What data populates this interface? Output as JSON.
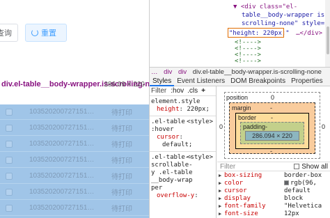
{
  "page": {
    "query_label": "查询",
    "reset_label": "重置",
    "tooltip": {
      "selector": "div.el-table__body-wrapper.is-scrolling-none",
      "dims": "286.09 × 220"
    },
    "rows": [
      {
        "id": "103520200727151…",
        "status": "待打印"
      },
      {
        "id": "103520200727151…",
        "status": "待打印"
      },
      {
        "id": "103520200727151…",
        "status": "待打印"
      },
      {
        "id": "103520200727151…",
        "status": "待打印"
      },
      {
        "id": "103520200727151…",
        "status": "待打印"
      },
      {
        "id": "103520200727151…",
        "status": "待打印"
      },
      {
        "id": "103520200727151…",
        "status": "待打印"
      }
    ]
  },
  "elements": {
    "line1_attr": "<div class=\"el-",
    "line2_attr": "table__body-wrapper is-",
    "line3_attr": "scrolling-none\" style=",
    "line4_style": "\"height: 220px;\"",
    "line4_tail": "…</div> ==",
    "comments": [
      "<!---->",
      "<!---->",
      "<!---->",
      "<!---->",
      "<!---->"
    ]
  },
  "breadcrumb": [
    "…",
    "div",
    "div",
    "div.el-table__body-wrapper.is-scrolling-none"
  ],
  "tabs": [
    "Styles",
    "Event Listeners",
    "DOM Breakpoints",
    "Properties"
  ],
  "styles": {
    "filter": "Filter",
    "hov": ":hov",
    "cls": ".cls",
    "plus": "+",
    "rules": [
      {
        "selector": "element.style",
        "source": "",
        "props": [
          {
            "name": "height",
            "value": "220px;"
          }
        ]
      },
      {
        "selector": ".el-table :hover",
        "source": "<style>",
        "props": [
          {
            "name": "cursor",
            "value": "default;"
          }
        ]
      },
      {
        "selector": ".el-table--scrollable-y .el-table__body-wrapper",
        "source": "<style>",
        "props": [
          {
            "name": "overflow-y",
            "value": ""
          }
        ]
      }
    ]
  },
  "box_model": {
    "position": "position",
    "position_val": "0",
    "margin": "margin",
    "margin_val": "-",
    "border": "border",
    "border_val": "-",
    "padding": "padding-",
    "content": "286.094 × 220",
    "side_left": "0",
    "side_right": "0",
    "bottom_dash": "-"
  },
  "computed": {
    "filter_placeholder": "Filter",
    "show_all": "Show all",
    "rows": [
      {
        "name": "box-sizing",
        "value": "border-box",
        "swatch": false
      },
      {
        "name": "color",
        "value": "rgb(96, ",
        "swatch": true
      },
      {
        "name": "cursor",
        "value": "default",
        "swatch": false
      },
      {
        "name": "display",
        "value": "block",
        "swatch": false
      },
      {
        "name": "font-family",
        "value": "\"Helvetica",
        "swatch": false
      },
      {
        "name": "font-size",
        "value": "12px",
        "swatch": false
      }
    ]
  },
  "colors": {
    "highlight": "#a0c5e8",
    "accent": "#409eff",
    "annotation": "#e06c00"
  }
}
